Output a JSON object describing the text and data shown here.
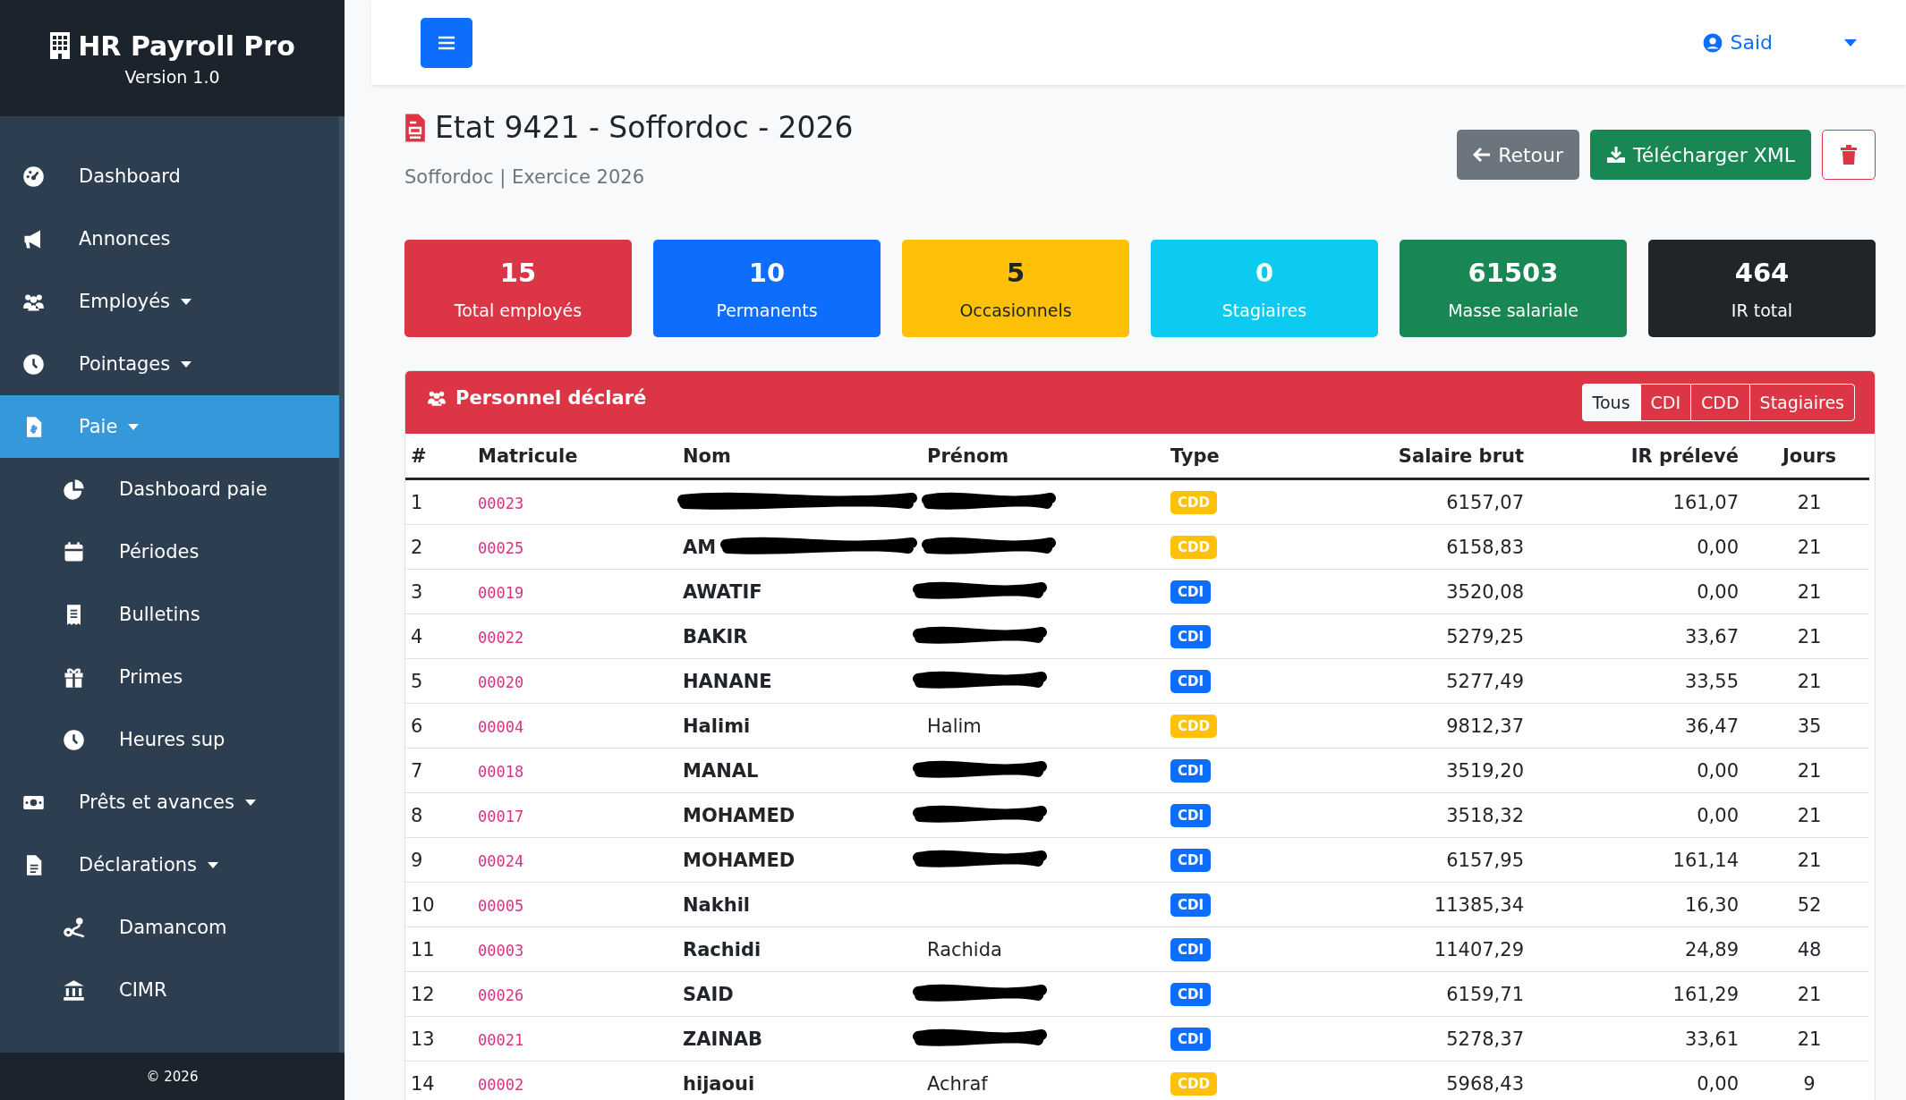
{
  "brand": {
    "title": "HR Payroll Pro",
    "version": "Version 1.0"
  },
  "sidebar": {
    "items": [
      {
        "label": "Dashboard",
        "kind": "item",
        "has_caret": false,
        "selected": false
      },
      {
        "label": "Annonces",
        "kind": "item",
        "has_caret": false,
        "selected": false
      },
      {
        "label": "Employés",
        "kind": "item",
        "has_caret": true,
        "selected": false
      },
      {
        "label": "Pointages",
        "kind": "item",
        "has_caret": true,
        "selected": false
      },
      {
        "label": "Paie",
        "kind": "item",
        "has_caret": true,
        "selected": true
      },
      {
        "label": "Dashboard paie",
        "kind": "subitem",
        "has_caret": false,
        "selected": false
      },
      {
        "label": "Périodes",
        "kind": "subitem",
        "has_caret": false,
        "selected": false
      },
      {
        "label": "Bulletins",
        "kind": "subitem",
        "has_caret": false,
        "selected": false
      },
      {
        "label": "Primes",
        "kind": "subitem",
        "has_caret": false,
        "selected": false
      },
      {
        "label": "Heures sup",
        "kind": "subitem",
        "has_caret": false,
        "selected": false
      },
      {
        "label": "Prêts et avances",
        "kind": "item",
        "has_caret": true,
        "selected": false
      },
      {
        "label": "Déclarations",
        "kind": "item",
        "has_caret": true,
        "selected": false
      },
      {
        "label": "Damancom",
        "kind": "subitem",
        "has_caret": false,
        "selected": false
      },
      {
        "label": "CIMR",
        "kind": "subitem",
        "has_caret": false,
        "selected": false
      }
    ],
    "footer": "© 2026"
  },
  "topbar": {
    "user": "Said"
  },
  "page": {
    "title": "Etat 9421 - Soffordoc - 2026",
    "subtitle": "Soffordoc | Exercice 2026",
    "buttons": [
      {
        "label": "Retour",
        "kind": "secondary"
      },
      {
        "label": "Télécharger XML",
        "kind": "success"
      },
      {
        "kind": "delete"
      }
    ]
  },
  "stats": [
    {
      "value": "15",
      "label": "Total employés",
      "kind": "danger"
    },
    {
      "value": "10",
      "label": "Permanents",
      "kind": "primary"
    },
    {
      "value": "5",
      "label": "Occasionnels",
      "kind": "warning"
    },
    {
      "value": "0",
      "label": "Stagiaires",
      "kind": "info"
    },
    {
      "value": "61503",
      "label": "Masse salariale",
      "kind": "success"
    },
    {
      "value": "464",
      "label": "IR total",
      "kind": "dark"
    }
  ],
  "table": {
    "title": "Personnel déclaré",
    "filters": [
      {
        "label": "Tous",
        "selected": true
      },
      {
        "label": "CDI",
        "selected": false
      },
      {
        "label": "CDD",
        "selected": false
      },
      {
        "label": "Stagiaires",
        "selected": false
      }
    ],
    "columns": [
      "#",
      "Matricule",
      "Nom",
      "Prénom",
      "Type",
      "Salaire brut",
      "IR prélevé",
      "Jours"
    ],
    "rows": [
      {
        "n": "1",
        "matricule": "00023",
        "name_redacted": true,
        "first_name_redacted": true,
        "type": {
          "label": "CDD",
          "color": "#ffc107"
        },
        "salaire": "6157,07",
        "ir": "161,07",
        "jours": "21"
      },
      {
        "n": "2",
        "matricule": "00025",
        "nom": "AM",
        "name_redacted": true,
        "first_name_redacted": true,
        "type": {
          "label": "CDD",
          "color": "#ffc107"
        },
        "salaire": "6158,83",
        "ir": "0,00",
        "jours": "21"
      },
      {
        "n": "3",
        "matricule": "00019",
        "nom": "AWATIF",
        "name_redacted": false,
        "first_name_redacted": true,
        "type": {
          "label": "CDI",
          "color": "#0d6efd"
        },
        "salaire": "3520,08",
        "ir": "0,00",
        "jours": "21"
      },
      {
        "n": "4",
        "matricule": "00022",
        "nom": "BAKIR",
        "name_redacted": false,
        "first_name_redacted": true,
        "type": {
          "label": "CDI",
          "color": "#0d6efd"
        },
        "salaire": "5279,25",
        "ir": "33,67",
        "jours": "21"
      },
      {
        "n": "5",
        "matricule": "00020",
        "nom": "HANANE",
        "name_redacted": false,
        "first_name_redacted": true,
        "type": {
          "label": "CDI",
          "color": "#0d6efd"
        },
        "salaire": "5277,49",
        "ir": "33,55",
        "jours": "21"
      },
      {
        "n": "6",
        "matricule": "00004",
        "nom": "Halimi",
        "prenom": "Halim",
        "name_redacted": false,
        "first_name_redacted": false,
        "type": {
          "label": "CDD",
          "color": "#ffc107"
        },
        "salaire": "9812,37",
        "ir": "36,47",
        "jours": "35"
      },
      {
        "n": "7",
        "matricule": "00018",
        "nom": "MANAL",
        "name_redacted": false,
        "first_name_redacted": true,
        "type": {
          "label": "CDI",
          "color": "#0d6efd"
        },
        "salaire": "3519,20",
        "ir": "0,00",
        "jours": "21"
      },
      {
        "n": "8",
        "matricule": "00017",
        "nom": "MOHAMED",
        "name_redacted": false,
        "first_name_redacted": true,
        "type": {
          "label": "CDI",
          "color": "#0d6efd"
        },
        "salaire": "3518,32",
        "ir": "0,00",
        "jours": "21"
      },
      {
        "n": "9",
        "matricule": "00024",
        "nom": "MOHAMED",
        "name_redacted": false,
        "first_name_redacted": true,
        "type": {
          "label": "CDI",
          "color": "#0d6efd"
        },
        "salaire": "6157,95",
        "ir": "161,14",
        "jours": "21"
      },
      {
        "n": "10",
        "matricule": "00005",
        "nom": "Nakhil",
        "name_redacted": false,
        "first_name_redacted": false,
        "type": {
          "label": "CDI",
          "color": "#0d6efd"
        },
        "salaire": "11385,34",
        "ir": "16,30",
        "jours": "52"
      },
      {
        "n": "11",
        "matricule": "00003",
        "nom": "Rachidi",
        "prenom": "Rachida",
        "name_redacted": false,
        "first_name_redacted": false,
        "type": {
          "label": "CDI",
          "color": "#0d6efd"
        },
        "salaire": "11407,29",
        "ir": "24,89",
        "jours": "48"
      },
      {
        "n": "12",
        "matricule": "00026",
        "nom": "SAID",
        "name_redacted": false,
        "first_name_redacted": true,
        "type": {
          "label": "CDI",
          "color": "#0d6efd"
        },
        "salaire": "6159,71",
        "ir": "161,29",
        "jours": "21"
      },
      {
        "n": "13",
        "matricule": "00021",
        "nom": "ZAINAB",
        "name_redacted": false,
        "first_name_redacted": true,
        "type": {
          "label": "CDI",
          "color": "#0d6efd"
        },
        "salaire": "5278,37",
        "ir": "33,61",
        "jours": "21"
      },
      {
        "n": "14",
        "matricule": "00002",
        "nom": "hijaoui",
        "prenom": "Achraf",
        "name_redacted": false,
        "first_name_redacted": false,
        "type": {
          "label": "CDD",
          "color": "#ffc107"
        },
        "salaire": "5968,43",
        "ir": "0,00",
        "jours": "9"
      }
    ]
  }
}
